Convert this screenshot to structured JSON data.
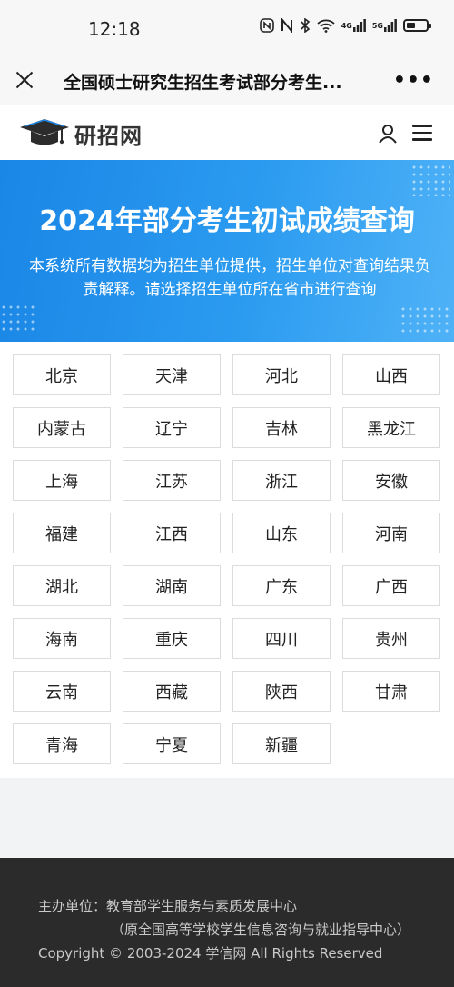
{
  "status_bar": {
    "time": "12:18",
    "signal_labels": [
      "4G",
      "5G"
    ]
  },
  "browser": {
    "title": "全国硕士研究生招生考试部分考生...",
    "close_icon": "close-icon",
    "more_icon": "more-icon"
  },
  "site": {
    "logo_text": "研招网",
    "logo_icon": "graduation-cap-icon",
    "user_icon": "user-icon",
    "menu_icon": "hamburger-menu-icon"
  },
  "banner": {
    "title": "2024年部分考生初试成绩查询",
    "description": "本系统所有数据均为招生单位提供，招生单位对查询结果负责解释。请选择招生单位所在省市进行查询"
  },
  "provinces": [
    "北京",
    "天津",
    "河北",
    "山西",
    "内蒙古",
    "辽宁",
    "吉林",
    "黑龙江",
    "上海",
    "江苏",
    "浙江",
    "安徽",
    "福建",
    "江西",
    "山东",
    "河南",
    "湖北",
    "湖南",
    "广东",
    "广西",
    "海南",
    "重庆",
    "四川",
    "贵州",
    "云南",
    "西藏",
    "陕西",
    "甘肃",
    "青海",
    "宁夏",
    "新疆"
  ],
  "footer": {
    "line1": "主办单位：教育部学生服务与素质发展中心",
    "line2": "（原全国高等学校学生信息咨询与就业指导中心）",
    "line3": "Copyright © 2003-2024 学信网 All Rights Reserved"
  },
  "colors": {
    "banner_start": "#1a86e6",
    "banner_end": "#4fb2f7",
    "footer_bg": "#2b2b2b"
  }
}
